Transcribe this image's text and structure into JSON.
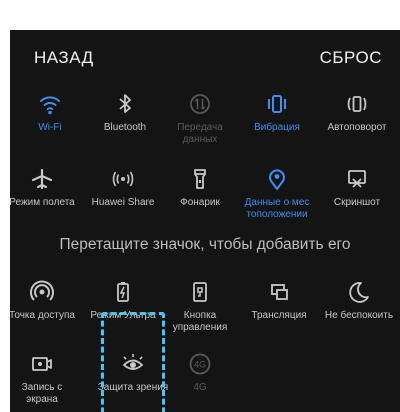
{
  "header": {
    "back_label": "НАЗАД",
    "reset_label": "СБРОС"
  },
  "colors": {
    "active": "#3e8ef0",
    "normal": "#c8c8c8",
    "disabled": "#5a5a5a",
    "drag_outline": "#41c7f5"
  },
  "active_tiles": [
    {
      "label": "Wi-Fi",
      "icon": "wifi-icon",
      "state": "active"
    },
    {
      "label": "Bluetooth",
      "icon": "bluetooth-icon",
      "state": "normal"
    },
    {
      "label": "Передача данных",
      "icon": "data-transfer-icon",
      "state": "disabled"
    },
    {
      "label": "Вибрация",
      "icon": "vibration-icon",
      "state": "active"
    },
    {
      "label": "Автоповорот",
      "icon": "autorotate-icon",
      "state": "normal"
    },
    {
      "label": "Режим полета",
      "icon": "airplane-icon",
      "state": "normal"
    },
    {
      "label": "Huawei Share",
      "icon": "huawei-share-icon",
      "state": "normal"
    },
    {
      "label": "Фонарик",
      "icon": "flashlight-icon",
      "state": "normal"
    },
    {
      "label": "Данные о мес тоположении",
      "icon": "location-icon",
      "state": "active"
    },
    {
      "label": "Скриншот",
      "icon": "screenshot-icon",
      "state": "normal"
    }
  ],
  "divider_text": "Перетащите значок, чтобы добавить его",
  "available_tiles": [
    {
      "label": "Точка доступа",
      "icon": "hotspot-icon",
      "state": "normal"
    },
    {
      "label": "Режим Ультра",
      "icon": "ultra-power-icon",
      "state": "normal"
    },
    {
      "label": "Кнопка управления",
      "icon": "navigation-dock-icon",
      "state": "normal"
    },
    {
      "label": "Трансляция",
      "icon": "cast-icon",
      "state": "normal"
    },
    {
      "label": "Не беспокоить",
      "icon": "do-not-disturb-icon",
      "state": "normal"
    },
    {
      "label": "Запись с экрана",
      "icon": "screen-record-icon",
      "state": "normal"
    },
    {
      "label": "Защита зрения",
      "icon": "eye-comfort-icon",
      "state": "normal"
    },
    {
      "label": "4G",
      "icon": "4g-icon",
      "state": "disabled"
    }
  ]
}
